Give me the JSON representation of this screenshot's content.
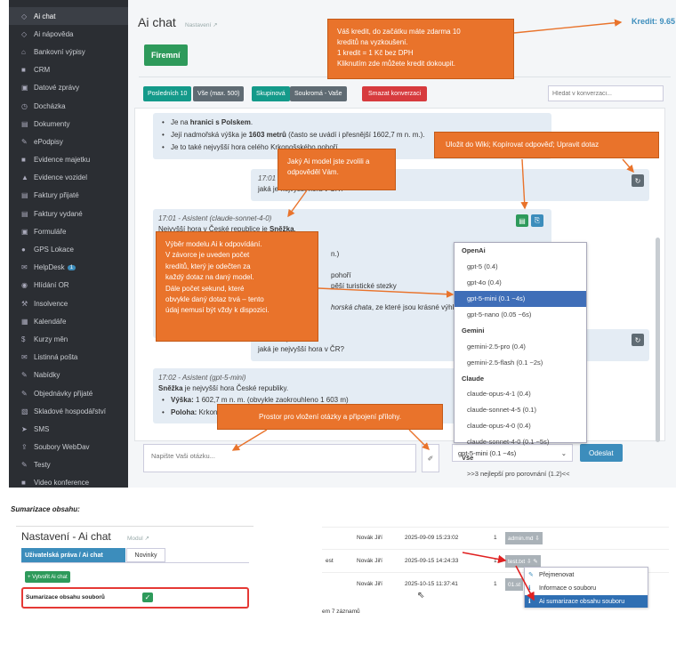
{
  "sidebar": {
    "items": [
      {
        "label": "Ai chat",
        "icon": "chat-icon",
        "glyph": "◇"
      },
      {
        "label": "Ai nápověda",
        "icon": "chat-icon",
        "glyph": "◇"
      },
      {
        "label": "Bankovní výpisy",
        "icon": "bank-icon",
        "glyph": "⌂"
      },
      {
        "label": "CRM",
        "icon": "file-icon",
        "glyph": "■"
      },
      {
        "label": "Datové zprávy",
        "icon": "inbox-icon",
        "glyph": "▣"
      },
      {
        "label": "Docházka",
        "icon": "clock-icon",
        "glyph": "◷"
      },
      {
        "label": "Dokumenty",
        "icon": "document-icon",
        "glyph": "▤"
      },
      {
        "label": "ePodpisy",
        "icon": "edit-icon",
        "glyph": "✎"
      },
      {
        "label": "Evidence majetku",
        "icon": "book-icon",
        "glyph": "■"
      },
      {
        "label": "Evidence vozidel",
        "icon": "car-icon",
        "glyph": "▲"
      },
      {
        "label": "Faktury přijaté",
        "icon": "invoice-icon",
        "glyph": "▤"
      },
      {
        "label": "Faktury vydané",
        "icon": "invoice-icon",
        "glyph": "▤"
      },
      {
        "label": "Formuláře",
        "icon": "form-icon",
        "glyph": "▣"
      },
      {
        "label": "GPS Lokace",
        "icon": "globe-icon",
        "glyph": "●"
      },
      {
        "label": "HelpDesk",
        "icon": "mail-icon",
        "glyph": "✉",
        "badge": "1"
      },
      {
        "label": "Hlídání OR",
        "icon": "eye-icon",
        "glyph": "◉"
      },
      {
        "label": "Insolvence",
        "icon": "gavel-icon",
        "glyph": "⚒"
      },
      {
        "label": "Kalendáře",
        "icon": "calendar-icon",
        "glyph": "▦"
      },
      {
        "label": "Kurzy měn",
        "icon": "dollar-icon",
        "glyph": "$"
      },
      {
        "label": "Listinná pošta",
        "icon": "envelope-icon",
        "glyph": "✉"
      },
      {
        "label": "Nabídky",
        "icon": "edit-icon",
        "glyph": "✎"
      },
      {
        "label": "Objednávky přijaté",
        "icon": "edit-icon",
        "glyph": "✎"
      },
      {
        "label": "Skladové hospodářství",
        "icon": "box-icon",
        "glyph": "▧"
      },
      {
        "label": "SMS",
        "icon": "send-icon",
        "glyph": "➤"
      },
      {
        "label": "Soubory WebDav",
        "icon": "upload-icon",
        "glyph": "⇪"
      },
      {
        "label": "Testy",
        "icon": "pencil-icon",
        "glyph": "✎"
      },
      {
        "label": "Video konference",
        "icon": "video-icon",
        "glyph": "■"
      }
    ]
  },
  "header": {
    "title": "Ai chat",
    "settings_link": "Nastavení",
    "credit": "Kredit: 9.65",
    "modules_button": "Firemní"
  },
  "toolbar": {
    "last10": "Posledních 10",
    "all": "Vše (max. 500)",
    "group": "Skupinová",
    "private": "Soukromá - Vaše",
    "delete": "Smazat konverzaci",
    "search_placeholder": "Hledat v konverzaci..."
  },
  "chat": {
    "msg1": {
      "b1_a": "Je na ",
      "b1_b": "hranici s Polskem",
      "b1_c": ".",
      "b2_a": "Její nadmořská výška je ",
      "b2_b": "1603 metrů",
      "b2_c": " (často se uvádí i přesnější 1602,7 m n. m.).",
      "b3": "Je to také nejvyšší hora celého Krkonošského pohoří."
    },
    "q1": {
      "time": "17:01 - Vy",
      "text": "jaká je nejvyšší hora v ČR?"
    },
    "a1": {
      "meta": "17:01 - Asistent (claude-sonnet-4-0)",
      "l1a": "Nejvyšší hora v České republice je ",
      "l1b": "Sněžka",
      "l1c": ".",
      "frag1": "n.)",
      "frag2": "pohoří",
      "frag3": "pěší turistické stezky",
      "frag4": "horská chata",
      "frag5": ", ze které jsou krásné výhl"
    },
    "q2": {
      "time": "17:02 - Vy",
      "text": "jaká je nejvyšší hora v ČR?"
    },
    "a2": {
      "meta": "17:02 - Asistent (gpt-5-mini)",
      "l1a": "Sněžka",
      "l1b": " je nejvyšší hora České republiky.",
      "b1a": "Výška:",
      "b1b": " 1 602,7 m n. m. (obvykle zaokrouhleno 1 603 m)",
      "b2a": "Poloha:",
      "b2b": " Krkonoše"
    }
  },
  "input": {
    "placeholder": "Napište Vaši otázku...",
    "model_value": "gpt-5-mini (0.1 ~4s)",
    "send": "Odeslat"
  },
  "dropdown": {
    "groups": [
      {
        "name": "OpenAi",
        "items": [
          "gpt-5 (0.4)",
          "gpt-4o (0.4)",
          "gpt-5-mini (0.1 ~4s)",
          "gpt-5-nano (0.05 ~6s)"
        ]
      },
      {
        "name": "Gemini",
        "items": [
          "gemini-2.5-pro (0.4)",
          "gemini-2.5-flash (0.1 ~2s)"
        ]
      },
      {
        "name": "Claude",
        "items": [
          "claude-opus-4-1 (0.4)",
          "claude-sonnet-4-5 (0.1)",
          "claude-opus-4-0 (0.4)",
          "claude-sonnet-4-0 (0.1 ~5s)"
        ]
      },
      {
        "name": "Vše",
        "items": [
          ">>3 nejlepší pro porovnání (1.2)<<"
        ]
      }
    ],
    "selected": "gpt-5-mini (0.1 ~4s)"
  },
  "notes": {
    "credit": [
      "Váš kredit, do začátku máte zdarma 10",
      "kreditů na vyzkoušení.",
      "1 kredit = 1 Kč bez DPH",
      "Kliknutím zde můžete kredit dokoupit."
    ],
    "save": "Uložit do Wiki; Kopírovat odpověď; Upravit dotaz",
    "model": [
      "Jaký Ai model jste zvolili a",
      "odpověděl Vám."
    ],
    "select": [
      "Výběr modelu Ai k odpovídání.",
      "V závorce je uveden počet",
      "kreditů, který je odečten za",
      "každý dotaz na daný model.",
      "Dále počet sekund, které",
      "obvykle daný dotaz trvá – tento",
      "údaj nemusí být vždy k dispozici."
    ],
    "input": "Prostor pro vložení otázky a připojení přílohy."
  },
  "summary": {
    "section_title": "Sumarizace obsahu:",
    "settings_title": "Nastavení - Ai chat",
    "modul_link": "Modul",
    "tab_active": "Uživatelská práva / Ai chat",
    "tab_other": "Novinky",
    "create_btn": "Vytvořit Ai chat",
    "option_label": "Sumarizace obsahu souborů",
    "files": [
      {
        "prefix": "",
        "author": "Novák Jiří",
        "date": "2025-09-09 15:23:02",
        "count": "1",
        "file": "admin.md"
      },
      {
        "prefix": "est",
        "author": "Novák Jiří",
        "date": "2025-09-15 14:24:33",
        "count": "1",
        "file": "test.txt"
      },
      {
        "prefix": "",
        "author": "Novák Jiří",
        "date": "2025-10-15 11:37:41",
        "count": "1",
        "file": "01.st"
      }
    ],
    "menu": [
      "Přejmenovat",
      "Informace o souboru",
      "Ai sumarizace obsahu souboru"
    ],
    "records": "em 7 záznamů"
  }
}
